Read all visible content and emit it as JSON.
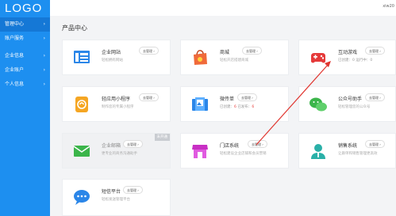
{
  "sidebar": {
    "logo": "LOGO",
    "items": [
      {
        "label": "管理中心"
      },
      {
        "label": "账户服务"
      },
      {
        "label": "企业信息"
      },
      {
        "label": "企业账户"
      },
      {
        "label": "个人信息"
      }
    ],
    "chevron": "›"
  },
  "header": {
    "user": "xiw20"
  },
  "main": {
    "title": "产品中心",
    "manage_label": "去管理 ›",
    "cards": [
      {
        "name": "企业网站",
        "desc": "轻松拥有网站",
        "icon": "website-icon"
      },
      {
        "name": "商城",
        "desc": "轻松开店搭建商城",
        "icon": "mall-bag-icon"
      },
      {
        "name": "互动游戏",
        "stats_prefix": "已创建：",
        "stats_a": "0",
        "stats_mid": "运行中：",
        "stats_b": "0",
        "icon": "game-controller-icon"
      },
      {
        "name": "轻应用小程序",
        "desc": "制作您的专属小程序",
        "icon": "mini-program-icon"
      },
      {
        "name": "微传单",
        "stats_prefix": "已创建：",
        "stats_a": "6",
        "stats_mid": "已发布：",
        "stats_b": "6",
        "icon": "flyer-icon"
      },
      {
        "name": "公众号助手",
        "desc": "轻松管理您的公众号",
        "icon": "wechat-icon"
      },
      {
        "name": "企业邮箱",
        "desc": "更专业的商务沟通助手",
        "icon": "mail-icon",
        "badge": "未开通"
      },
      {
        "name": "门店系统",
        "desc": "轻松建设企业店铺和会员营销",
        "icon": "store-icon"
      },
      {
        "name": "销售系统",
        "desc": "让跟单和销售管理更高效",
        "icon": "sales-person-icon"
      },
      {
        "name": "短信平台",
        "desc": "轻松发送管理平台",
        "icon": "sms-bubble-icon"
      }
    ]
  },
  "colors": {
    "sidebar": "#1d8ff0",
    "sidebar_active": "#1578d6",
    "annotation_arrow": "#e0352f",
    "stat_highlight": "#e8423f"
  }
}
